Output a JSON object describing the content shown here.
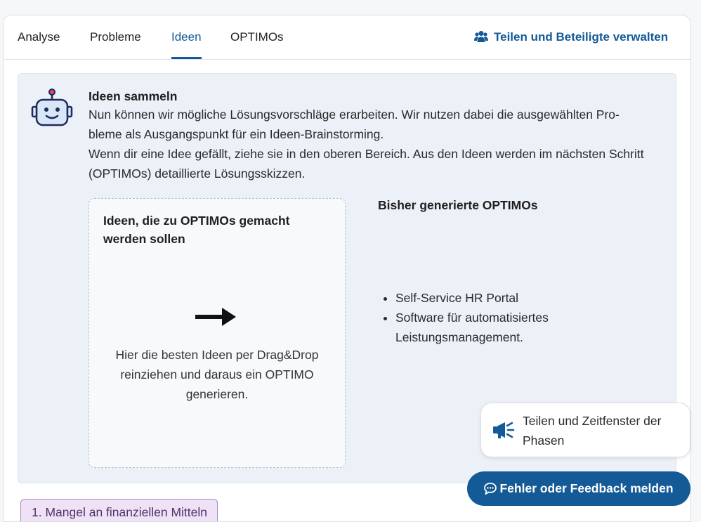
{
  "tabs": [
    {
      "label": "Analyse",
      "active": false
    },
    {
      "label": "Probleme",
      "active": false
    },
    {
      "label": "Ideen",
      "active": true
    },
    {
      "label": "OPTIMOs",
      "active": false
    }
  ],
  "share": {
    "label": "Teilen und Beteiligte verwalten",
    "icon": "users-icon"
  },
  "intro": {
    "heading": "Ideen sammeln",
    "line1": "Nun können wir mögliche Lösungsvorschläge erarbeiten. Wir nutzen dabei die ausgewählten Pro-",
    "line2": "bleme als Ausgangspunkt für ein Ideen-Brainstorming.",
    "line3": "Wenn dir eine Idee gefällt, ziehe sie in den oberen Bereich. Aus den Ideen werden im nächsten Schritt",
    "line4": "(OPTIMOs) detaillierte Lösungsskizzen.",
    "icon": "robot-icon"
  },
  "dropzone": {
    "title": "Ideen, die zu OPTIMOs gemacht werden sollen",
    "hint": "Hier die besten Ideen per Drag&Drop reinziehen und daraus ein OPTIMO generieren.",
    "icon": "arrow-right-icon"
  },
  "generated": {
    "title": "Bisher generierte OPTIMOs",
    "items": [
      "Self-Service HR Portal",
      "Software für automatisiertes Leistungsmanagement."
    ]
  },
  "phase_button": {
    "label": "Teilen und Zeitfenster der Phasen",
    "icon": "megaphone-icon"
  },
  "feedback_button": {
    "label": "Fehler oder Feedback melden",
    "icon": "chat-icon"
  },
  "problem_chip": {
    "label": "1. Mangel an finanziellen Mitteln"
  },
  "colors": {
    "accent": "#135a96",
    "panel": "#ecf0f7",
    "chip": "#efe2f7"
  }
}
